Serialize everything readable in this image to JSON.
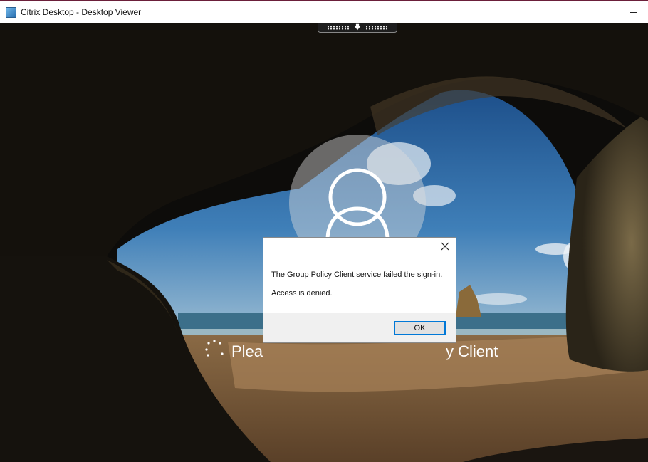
{
  "window": {
    "title": "Citrix Desktop - Desktop Viewer",
    "icon": "citrix-app-icon",
    "minimize_icon": "minimize-icon"
  },
  "toolbar": {
    "icon": "arrow-down-icon",
    "arrow_glyph": "🡇"
  },
  "lock_screen": {
    "avatar_icon": "user-icon",
    "status_left": "Plea",
    "status_right": "y Client"
  },
  "dialog": {
    "message": "The Group Policy Client service failed the sign-in.",
    "detail": "Access is denied.",
    "ok_label": "OK",
    "close_icon": "close-icon"
  },
  "colors": {
    "titlebar_accent": "#6b1f3a",
    "ok_border": "#0078d7",
    "sky": "#2d6aa8",
    "sand": "#b08a5c"
  }
}
